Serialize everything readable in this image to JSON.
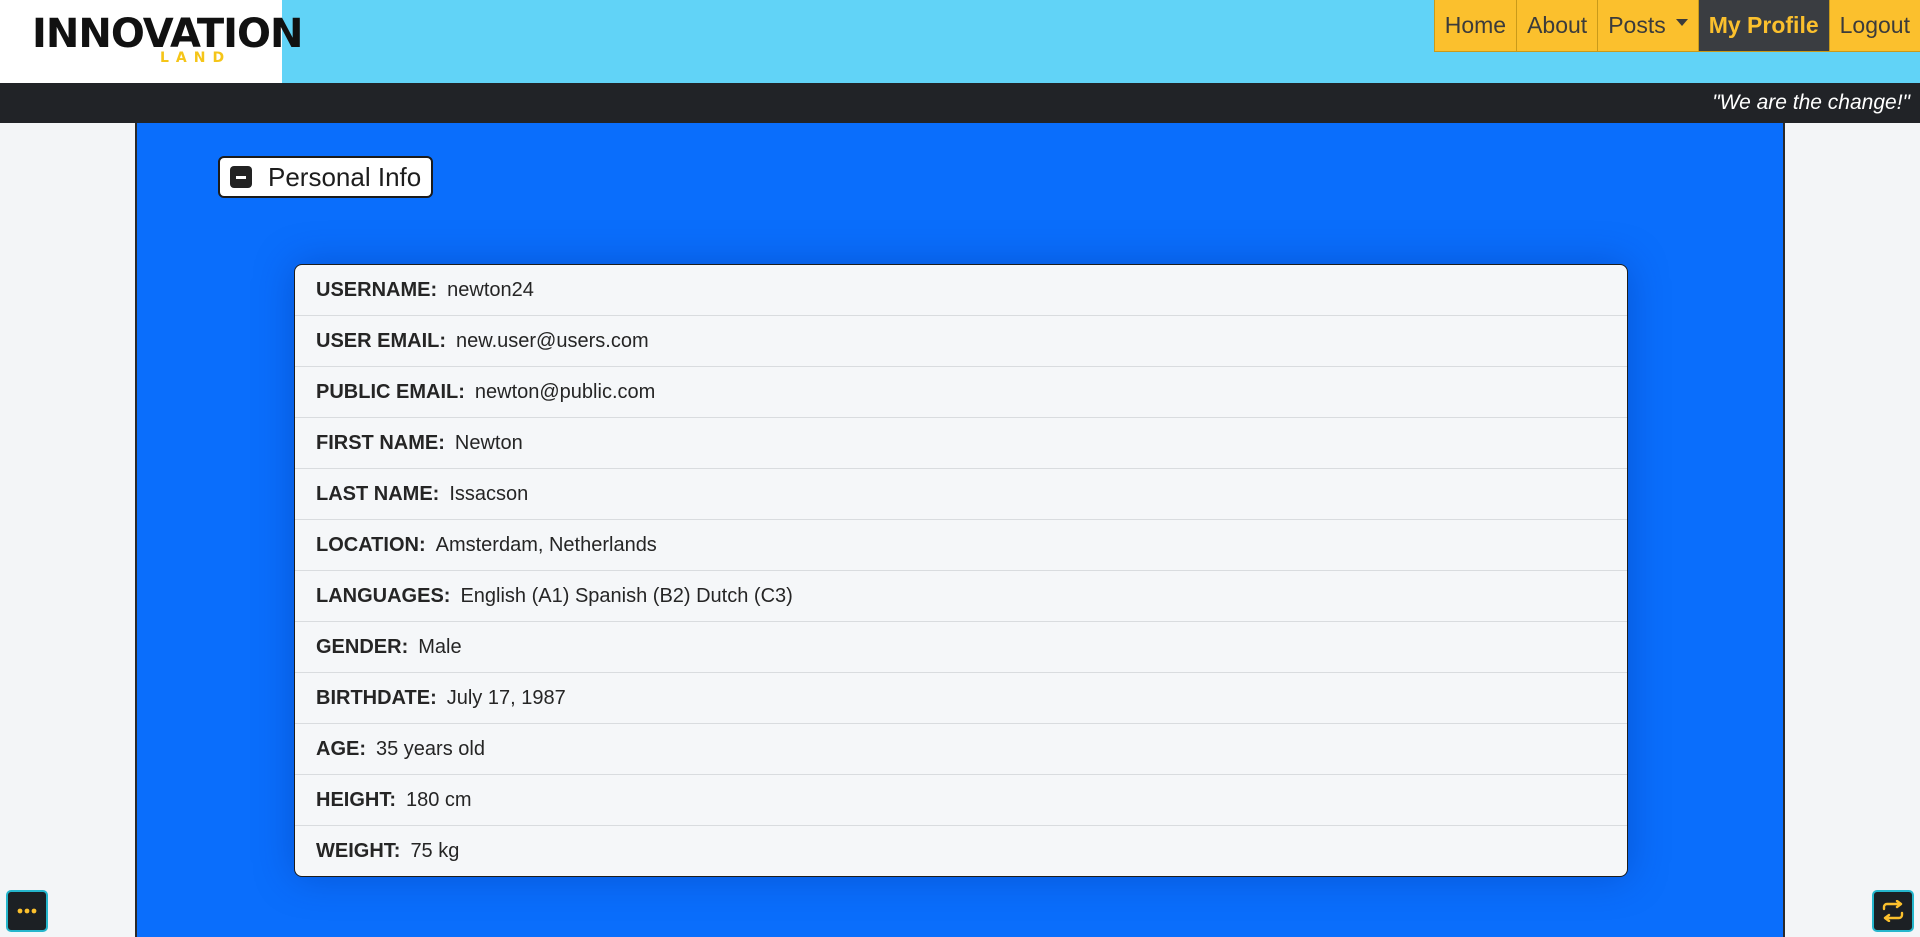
{
  "brand": {
    "logo_main": "INNOVATION",
    "logo_sub": "LAND"
  },
  "nav": {
    "items": [
      {
        "label": "Home"
      },
      {
        "label": "About"
      },
      {
        "label": "Posts"
      },
      {
        "label": "My Profile"
      },
      {
        "label": "Logout"
      }
    ]
  },
  "quote": "\"We are the change!\"",
  "section": {
    "title": "Personal Info",
    "toggle_icon": "minus-square-icon"
  },
  "profile": {
    "rows": [
      {
        "label": "USERNAME:",
        "value": "newton24"
      },
      {
        "label": "USER EMAIL:",
        "value": "new.user@users.com"
      },
      {
        "label": "PUBLIC EMAIL:",
        "value": "newton@public.com"
      },
      {
        "label": "FIRST NAME:",
        "value": "Newton"
      },
      {
        "label": "LAST NAME:",
        "value": "Issacson"
      },
      {
        "label": "LOCATION:",
        "value": "Amsterdam, Netherlands"
      },
      {
        "label": "LANGUAGES:",
        "value": "English (A1) Spanish (B2) Dutch (C3)"
      },
      {
        "label": "GENDER:",
        "value": "Male"
      },
      {
        "label": "BIRTHDATE:",
        "value": "July 17, 1987"
      },
      {
        "label": "AGE:",
        "value": "35 years old"
      },
      {
        "label": "HEIGHT:",
        "value": "180 cm"
      },
      {
        "label": "WEIGHT:",
        "value": "75 kg"
      }
    ]
  },
  "corner_buttons": {
    "left_icon": "more-dots-icon",
    "right_icon": "repeat-icon"
  },
  "colors": {
    "header_bg": "#61d3f7",
    "nav_bg": "#fbc02d",
    "nav_active_bg": "#3a3d41",
    "panel_bg": "#0a6efc",
    "quote_bar_bg": "#212327"
  }
}
